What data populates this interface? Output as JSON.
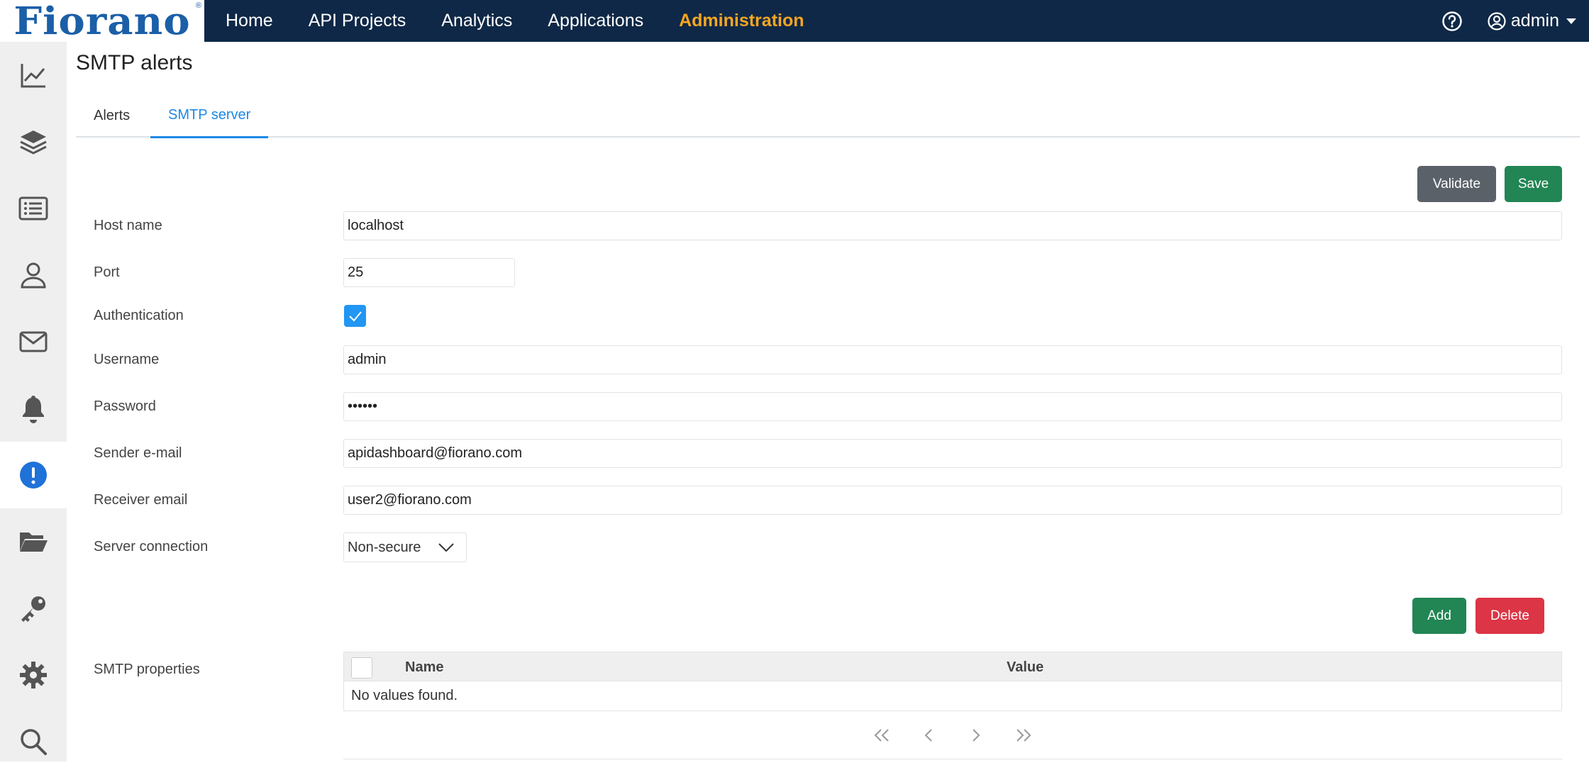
{
  "brand": {
    "logo_text": "Fiorano",
    "logo_mark": "®"
  },
  "nav": {
    "items": [
      "Home",
      "API Projects",
      "Analytics",
      "Applications",
      "Administration"
    ],
    "active": "Administration",
    "user": "admin"
  },
  "sidebar": {
    "icons": [
      "chart-line-icon",
      "layers-icon",
      "list-icon",
      "user-icon",
      "mail-icon",
      "bell-icon",
      "alert-circle-icon",
      "folder-open-icon",
      "key-icon",
      "gear-icon",
      "search-icon"
    ],
    "active": "alert-circle-icon"
  },
  "page": {
    "title": "SMTP alerts",
    "tabs": [
      "Alerts",
      "SMTP server"
    ],
    "active_tab": "SMTP server"
  },
  "toolbar": {
    "validate_label": "Validate",
    "save_label": "Save"
  },
  "form": {
    "host_label": "Host name",
    "host_value": "localhost",
    "port_label": "Port",
    "port_value": "25",
    "auth_label": "Authentication",
    "auth_checked": true,
    "username_label": "Username",
    "username_value": "admin",
    "password_label": "Password",
    "password_value": "••••••",
    "sender_label": "Sender e-mail",
    "sender_value": "apidashboard@fiorano.com",
    "receiver_label": "Receiver email",
    "receiver_value": "user2@fiorano.com",
    "connection_label": "Server connection",
    "connection_value": "Non-secure"
  },
  "properties": {
    "label": "SMTP properties",
    "add_label": "Add",
    "delete_label": "Delete",
    "columns": [
      "Name",
      "Value"
    ],
    "empty_text": "No values found."
  },
  "colors": {
    "topbar": "#0f2847",
    "active_nav": "#f5a623",
    "accent": "#1e88e5",
    "success": "#218554",
    "danger": "#dc3545",
    "secondary": "#5b6168"
  }
}
